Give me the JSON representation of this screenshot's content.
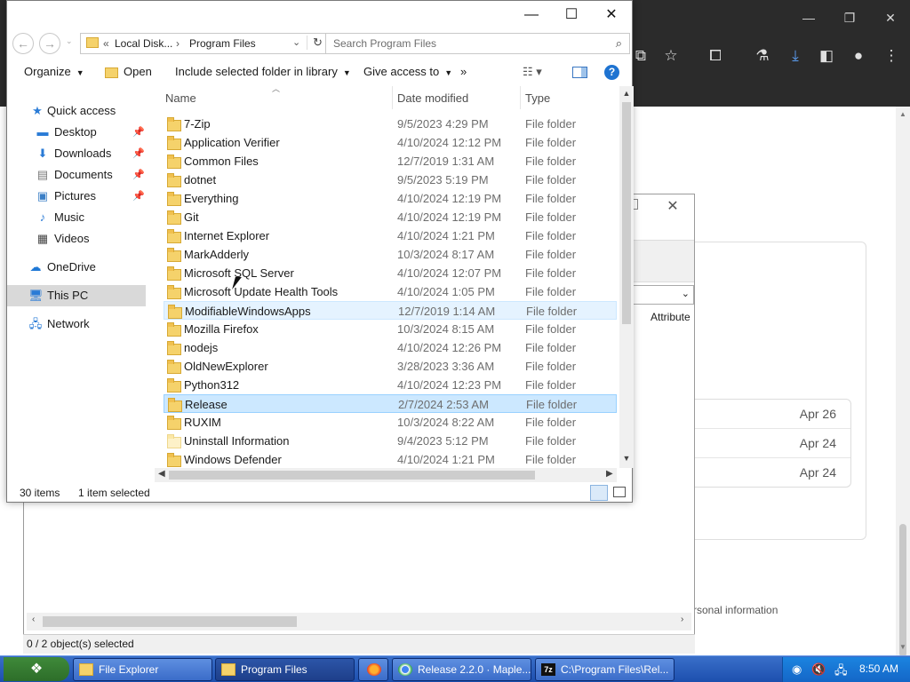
{
  "browser": {
    "window_controls": [
      "—",
      "❐",
      "✕"
    ],
    "toolbar_icons": [
      "cast-icon",
      "star-icon",
      "extensions-icon",
      "labs-icon",
      "download-icon",
      "sidebar-icon",
      "profile-icon",
      "menu-icon"
    ],
    "dates": [
      "Apr 26",
      "Apr 24",
      "Apr 24"
    ],
    "footer_text": "rsonal information"
  },
  "zip": {
    "status": "0 / 2 object(s) selected",
    "column_header": "Attribute"
  },
  "explorer": {
    "title_controls": {
      "minimize": "—",
      "maximize": "☐",
      "close": "✕"
    },
    "address": {
      "prefix": "«",
      "crumb1": "Local Disk...",
      "sep": "›",
      "crumb2": "Program Files"
    },
    "search_placeholder": "Search Program Files",
    "toolbar": {
      "organize": "Organize",
      "open": "Open",
      "include": "Include selected folder in library",
      "give_access": "Give access to",
      "more": "»"
    },
    "nav": {
      "quick_access": "Quick access",
      "desktop": "Desktop",
      "downloads": "Downloads",
      "documents": "Documents",
      "pictures": "Pictures",
      "music": "Music",
      "videos": "Videos",
      "onedrive": "OneDrive",
      "thispc": "This PC",
      "network": "Network"
    },
    "columns": {
      "name": "Name",
      "date": "Date modified",
      "type": "Type"
    },
    "files": [
      {
        "name": "7-Zip",
        "date": "9/5/2023 4:29 PM",
        "type": "File folder"
      },
      {
        "name": "Application Verifier",
        "date": "4/10/2024 12:12 PM",
        "type": "File folder"
      },
      {
        "name": "Common Files",
        "date": "12/7/2019 1:31 AM",
        "type": "File folder"
      },
      {
        "name": "dotnet",
        "date": "9/5/2023 5:19 PM",
        "type": "File folder"
      },
      {
        "name": "Everything",
        "date": "4/10/2024 12:19 PM",
        "type": "File folder"
      },
      {
        "name": "Git",
        "date": "4/10/2024 12:19 PM",
        "type": "File folder"
      },
      {
        "name": "Internet Explorer",
        "date": "4/10/2024 1:21 PM",
        "type": "File folder"
      },
      {
        "name": "MarkAdderly",
        "date": "10/3/2024 8:17 AM",
        "type": "File folder"
      },
      {
        "name": "Microsoft SQL Server",
        "date": "4/10/2024 12:07 PM",
        "type": "File folder"
      },
      {
        "name": "Microsoft Update Health Tools",
        "date": "4/10/2024 1:05 PM",
        "type": "File folder"
      },
      {
        "name": "ModifiableWindowsApps",
        "date": "12/7/2019 1:14 AM",
        "type": "File folder"
      },
      {
        "name": "Mozilla Firefox",
        "date": "10/3/2024 8:15 AM",
        "type": "File folder"
      },
      {
        "name": "nodejs",
        "date": "4/10/2024 12:26 PM",
        "type": "File folder"
      },
      {
        "name": "OldNewExplorer",
        "date": "3/28/2023 3:36 AM",
        "type": "File folder"
      },
      {
        "name": "Python312",
        "date": "4/10/2024 12:23 PM",
        "type": "File folder"
      },
      {
        "name": "Release",
        "date": "2/7/2024 2:53 AM",
        "type": "File folder"
      },
      {
        "name": "RUXIM",
        "date": "10/3/2024 8:22 AM",
        "type": "File folder"
      },
      {
        "name": "Uninstall Information",
        "date": "9/4/2023 5:12 PM",
        "type": "File folder"
      },
      {
        "name": "Windows Defender",
        "date": "4/10/2024 1:21 PM",
        "type": "File folder"
      }
    ],
    "selected_row": "Release",
    "hover_row": "ModifiableWindowsApps",
    "status": {
      "count": "30 items",
      "selected": "1 item selected"
    }
  },
  "taskbar": {
    "tasks": [
      "File Explorer",
      "Program Files",
      "Release 2.2.0 · Maple...",
      "C:\\Program Files\\Rel..."
    ],
    "clock": "8:50 AM"
  }
}
